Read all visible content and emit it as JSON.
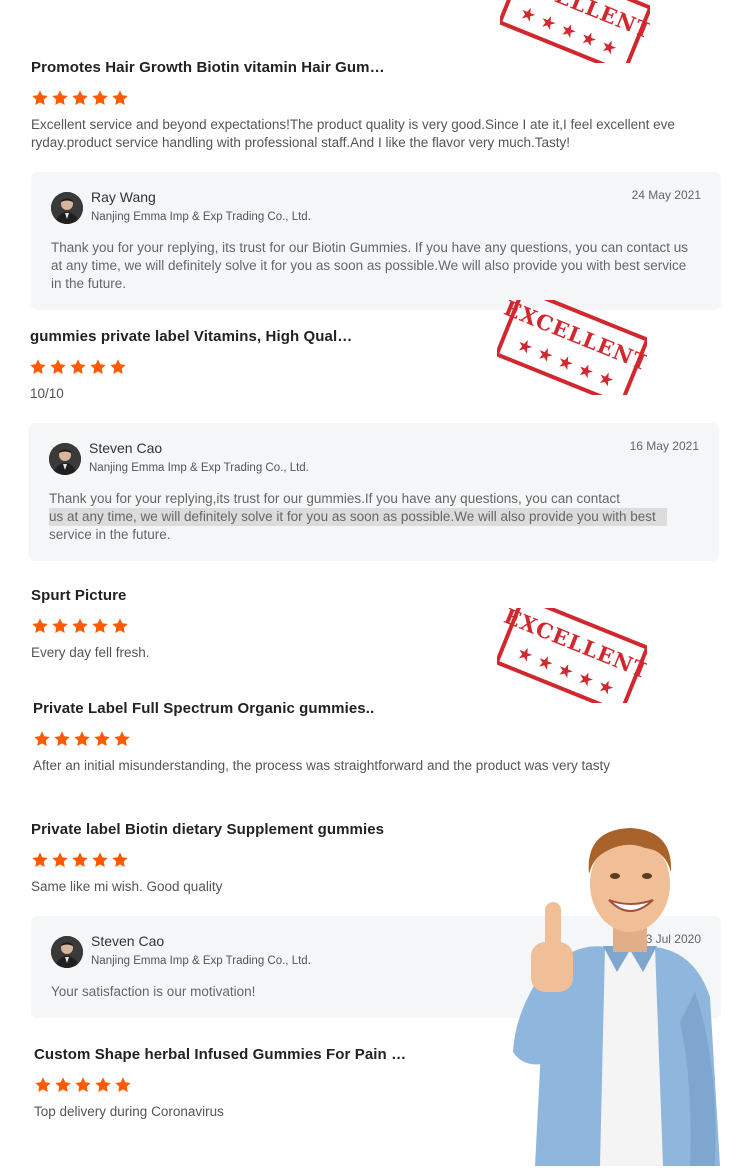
{
  "colors": {
    "star": "#ff5a00",
    "stamp": "#d0282e",
    "reply_bg": "#f5f6f8"
  },
  "stamp_text": "EXCELLENT",
  "reviews": [
    {
      "title": "Promotes Hair Growth Biotin vitamin Hair Gum…",
      "rating": 5,
      "text_lines": [
        "Excellent service and beyond expectations!The product quality is very good.Since I ate it,I feel excellent eve",
        "ryday.product service handling with professional staff.And I like the flavor very much.Tasty!"
      ],
      "reply": {
        "name": "Ray Wang",
        "company": "Nanjing Emma Imp & Exp Trading Co., Ltd.",
        "date": "24 May 2021",
        "text_lines": [
          "Thank you for your replying, its trust for our Biotin Gummies. If you have any questions, you can contact us",
          "at any time, we will definitely solve it for you as soon as possible.We will also provide you with best service",
          "in the future."
        ]
      }
    },
    {
      "title": "gummies private label Vitamins, High Qual…",
      "rating": 5,
      "text_lines": [
        "10/10"
      ],
      "reply": {
        "name": "Steven Cao",
        "company": "Nanjing Emma Imp & Exp Trading Co., Ltd.",
        "date": "16 May 2021",
        "text_lines": [
          "Thank you for your replying,its trust for our gummies.If you have any questions, you can contact",
          "us at any time, we will definitely solve it for you as soon as possible.We will also provide you with best",
          "service in the future."
        ]
      }
    },
    {
      "title": "Spurt Picture",
      "rating": 5,
      "text_lines": [
        "Every day fell fresh."
      ]
    },
    {
      "title": "Private Label Full Spectrum Organic  gummies..",
      "rating": 5,
      "text_lines": [
        "After an initial misunderstanding, the process was straightforward and the product was very tasty"
      ]
    },
    {
      "title": "Private label Biotin dietary Supplement  gummies",
      "rating": 5,
      "text_lines": [
        "Same like mi wish. Good quality"
      ],
      "reply": {
        "name": "Steven Cao",
        "company": "Nanjing Emma Imp & Exp Trading Co., Ltd.",
        "date": "23 Jul 2020",
        "text_lines": [
          "Your satisfaction is our motivation!"
        ]
      }
    },
    {
      "title": "Custom Shape herbal Infused Gummies For Pain …",
      "rating": 5,
      "text_lines": [
        "Top delivery during Coronavirus"
      ]
    }
  ]
}
